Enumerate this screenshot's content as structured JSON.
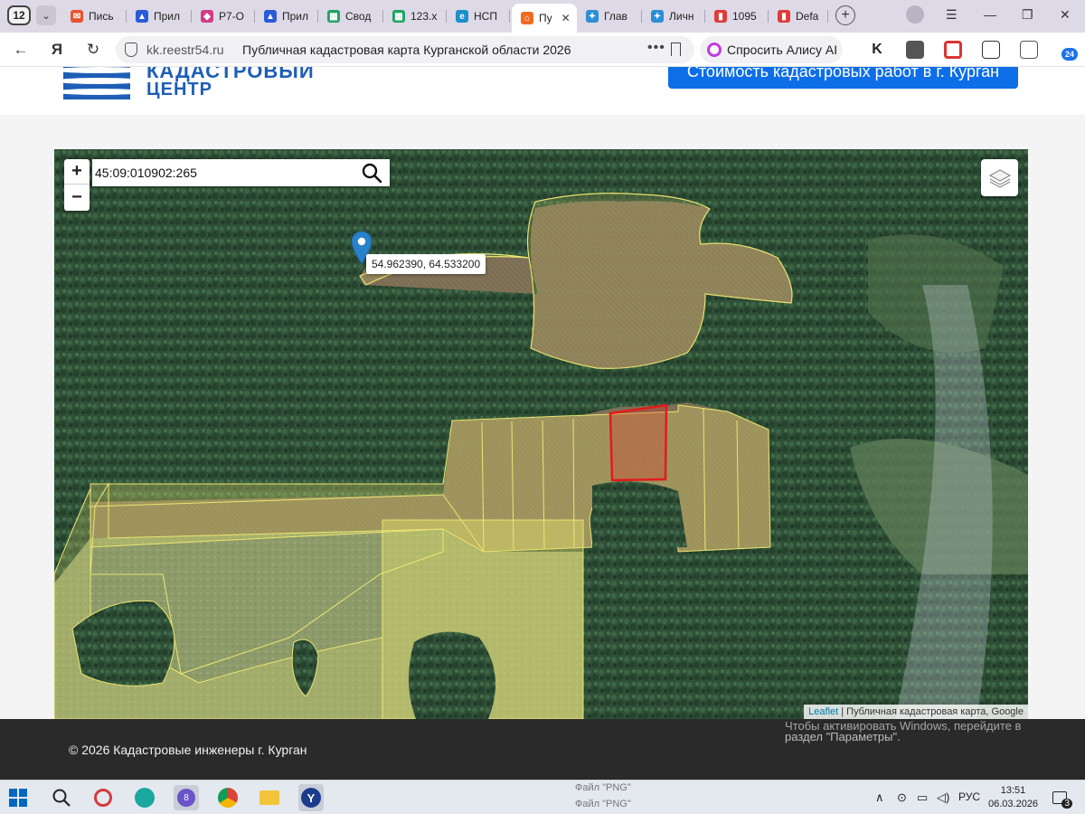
{
  "browser": {
    "tab_count": "12",
    "tabs": [
      {
        "label": "Пись",
        "color": "#e8532f"
      },
      {
        "label": "Прил",
        "color": "#2a5bd7"
      },
      {
        "label": "Р7-О",
        "color": "#d13b87"
      },
      {
        "label": "Прил",
        "color": "#2a5bd7"
      },
      {
        "label": "Свод",
        "color": "#21a366"
      },
      {
        "label": "123.x",
        "color": "#21a366"
      },
      {
        "label": "НСП",
        "color": "#1a8fc9"
      },
      {
        "label": "Пу",
        "color": "#f06a22"
      },
      {
        "label": "Глав",
        "color": "#2c8fd6"
      },
      {
        "label": "Личн",
        "color": "#2c8fd6"
      },
      {
        "label": "1095",
        "color": "#e03a3a"
      },
      {
        "label": "Defa",
        "color": "#e03a3a"
      }
    ],
    "active_tab_close": "✕",
    "url_host": "kk.reestr54.ru",
    "page_title": "Публичная кадастровая карта Курганской области 2026",
    "alice_label": "Спросить Алису AI",
    "ext_badge": "24"
  },
  "site": {
    "logo_line1": "КАДАСТРОВЫЙ",
    "logo_line2": "ЦЕНТР",
    "cta_label": "Стоимость кадастровых работ в г. Курган",
    "brand_color": "#1e5eb6",
    "cta_color": "#0d6ee8"
  },
  "map": {
    "zoom_in": "+",
    "zoom_out": "−",
    "search_value": "45:09:010902:265",
    "marker_coords": "54.962390, 64.533200",
    "attribution_link": "Leaflet",
    "attribution_text": " | Публичная кадастровая карта, Google",
    "parcel_fill": "#e3df6e",
    "selected_parcel_color": "#e21b1b"
  },
  "footer": {
    "copyright": "© 2026 Кадастровые инженеры г. Курган",
    "activation_line1": "Чтобы активировать Windows, перейдите в",
    "activation_line2": "раздел \"Параметры\"."
  },
  "taskbar": {
    "lang": "РУС",
    "time": "13:51",
    "date": "06.03.2026",
    "notif_count": "3",
    "bg_text1": "Файл \"PNG\"",
    "bg_text2": "Файл \"PNG\"",
    "app_badge": "8"
  }
}
